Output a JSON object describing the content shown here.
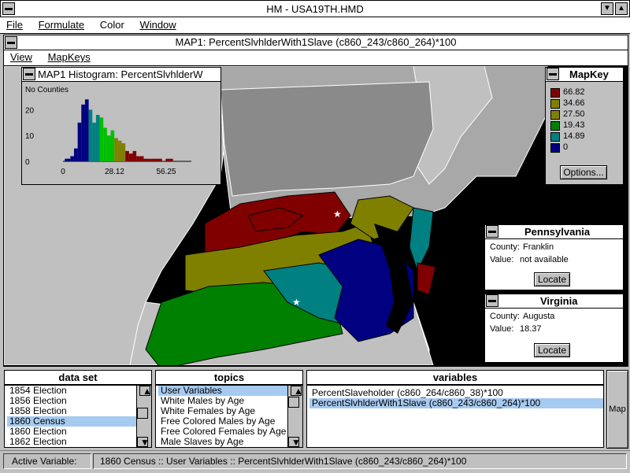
{
  "app": {
    "title": "HM - USA19TH.HMD",
    "menu": [
      "File",
      "Formulate",
      "Color",
      "Window"
    ]
  },
  "map_window": {
    "title": "MAP1: PercentSlvhlderWith1Slave (c860_243/c860_264)*100",
    "menu": [
      "View",
      "MapKeys"
    ]
  },
  "histogram": {
    "title": "MAP1 Histogram: PercentSlvhlderW",
    "ylabel": "No Counties",
    "yticks": [
      "20",
      "10",
      "0"
    ],
    "xticks": [
      "0",
      "28.12",
      "56.25"
    ],
    "colors": [
      "#000080",
      "#008080",
      "#00c000",
      "#808000",
      "#800000"
    ]
  },
  "chart_data": {
    "type": "bar",
    "title": "MAP1 Histogram: PercentSlvhlderW",
    "ylabel": "No Counties",
    "xlabel": "",
    "ylim": [
      0,
      25
    ],
    "xlim": [
      0,
      70
    ],
    "x": [
      2,
      3,
      5,
      7,
      9,
      11,
      13,
      15,
      17,
      19,
      21,
      23,
      25,
      27,
      29,
      31,
      33,
      35,
      37,
      39,
      41,
      43,
      45,
      47,
      49,
      51,
      53,
      55,
      57,
      59
    ],
    "values": [
      1,
      1,
      2,
      5,
      15,
      22,
      24,
      20,
      15,
      18,
      17,
      13,
      10,
      12,
      9,
      8,
      7,
      4,
      3,
      4,
      2,
      2,
      1,
      1,
      1,
      1,
      1,
      0,
      1,
      1
    ]
  },
  "mapkey": {
    "title": "MapKey",
    "entries": [
      {
        "label": "66.82",
        "color": "#800000"
      },
      {
        "label": "34.66",
        "color": "#808000"
      },
      {
        "label": "27.50",
        "color": "#808000"
      },
      {
        "label": "19.43",
        "color": "#008000"
      },
      {
        "label": "14.89",
        "color": "#008080"
      },
      {
        "label": "0",
        "color": "#000080"
      }
    ],
    "options_button": "Options..."
  },
  "pennsylvania": {
    "title": "Pennsylvania",
    "county_label": "County:",
    "county": "Franklin",
    "value_label": "Value:",
    "value": "not available",
    "locate": "Locate"
  },
  "virginia": {
    "title": "Virginia",
    "county_label": "County:",
    "county": "Augusta",
    "value_label": "Value:",
    "value": "18.37",
    "locate": "Locate"
  },
  "dataset": {
    "title": "data set",
    "items": [
      "1854 Election",
      "1856 Election",
      "1858 Election",
      "1860 Census",
      "1860 Election",
      "1862 Election"
    ],
    "selected": "1860 Census"
  },
  "topics": {
    "title": "topics",
    "items": [
      "User Variables",
      "White Males by Age",
      "White Females by Age",
      "Free Colored Males by Age",
      "Free Colored Females by Age",
      "Male Slaves by Age"
    ],
    "selected": "User Variables"
  },
  "variables": {
    "title": "variables",
    "items": [
      "PercentSlaveholder (c860_264/c860_38)*100",
      "PercentSlvhlderWith1Slave (c860_243/c860_264)*100"
    ],
    "selected": "PercentSlvhlderWith1Slave (c860_243/c860_264)*100"
  },
  "map_button": "Map",
  "status": {
    "label": "Active Variable:",
    "value": "1860 Census :: User Variables :: PercentSlvhlderWith1Slave (c860_243/c860_264)*100"
  }
}
